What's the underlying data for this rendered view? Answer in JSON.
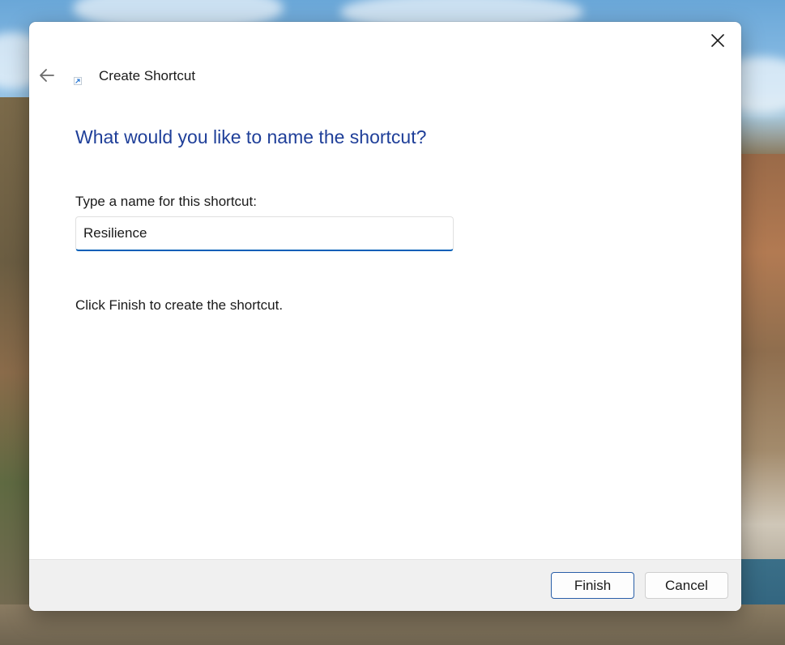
{
  "window": {
    "title": "Create Shortcut",
    "close_icon": "close-icon",
    "back_icon": "arrow-left-icon",
    "title_icon": "shortcut-icon"
  },
  "content": {
    "heading": "What would you like to name the shortcut?",
    "field_label": "Type a name for this shortcut:",
    "field_value": "Resilience",
    "instruction": "Click Finish to create the shortcut."
  },
  "footer": {
    "finish_label": "Finish",
    "cancel_label": "Cancel"
  },
  "colors": {
    "heading": "#1f3f99",
    "input_underline": "#005fb8",
    "footer_bg": "#f0f0f0",
    "primary_border": "#2a5fa8"
  }
}
